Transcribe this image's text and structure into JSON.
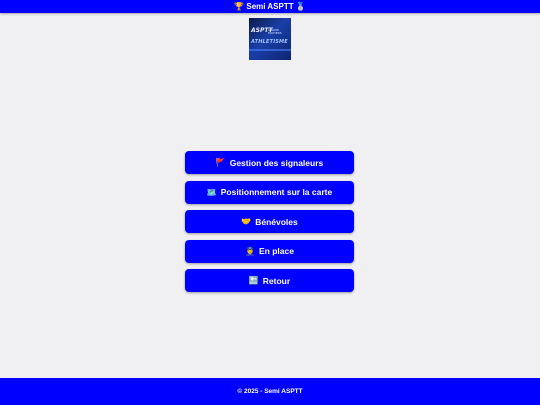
{
  "header": {
    "title": "🏆 Semi ASPTT 🥈"
  },
  "logo": {
    "line1": "ASPTT",
    "line2": "GRAND POITIERS",
    "line3": "ATHLETISME"
  },
  "menu": {
    "items": [
      {
        "icon": "🚩",
        "icon_name": "flag-icon",
        "label": "Gestion des signaleurs"
      },
      {
        "icon": "🗺️",
        "icon_name": "map-icon",
        "label": "Positionnement sur la carte"
      },
      {
        "icon": "🤝",
        "icon_name": "handshake-icon",
        "label": "Bénévoles"
      },
      {
        "icon": "👮",
        "icon_name": "police-officer-icon",
        "label": "En place"
      },
      {
        "icon": "🔙",
        "icon_name": "back-arrow-icon",
        "label": "Retour"
      }
    ]
  },
  "footer": {
    "text": "© 2025 - Semi ASPTT"
  },
  "colors": {
    "accent": "#0000ff",
    "background": "#f0eff2",
    "text_on_accent": "#ffffff"
  }
}
